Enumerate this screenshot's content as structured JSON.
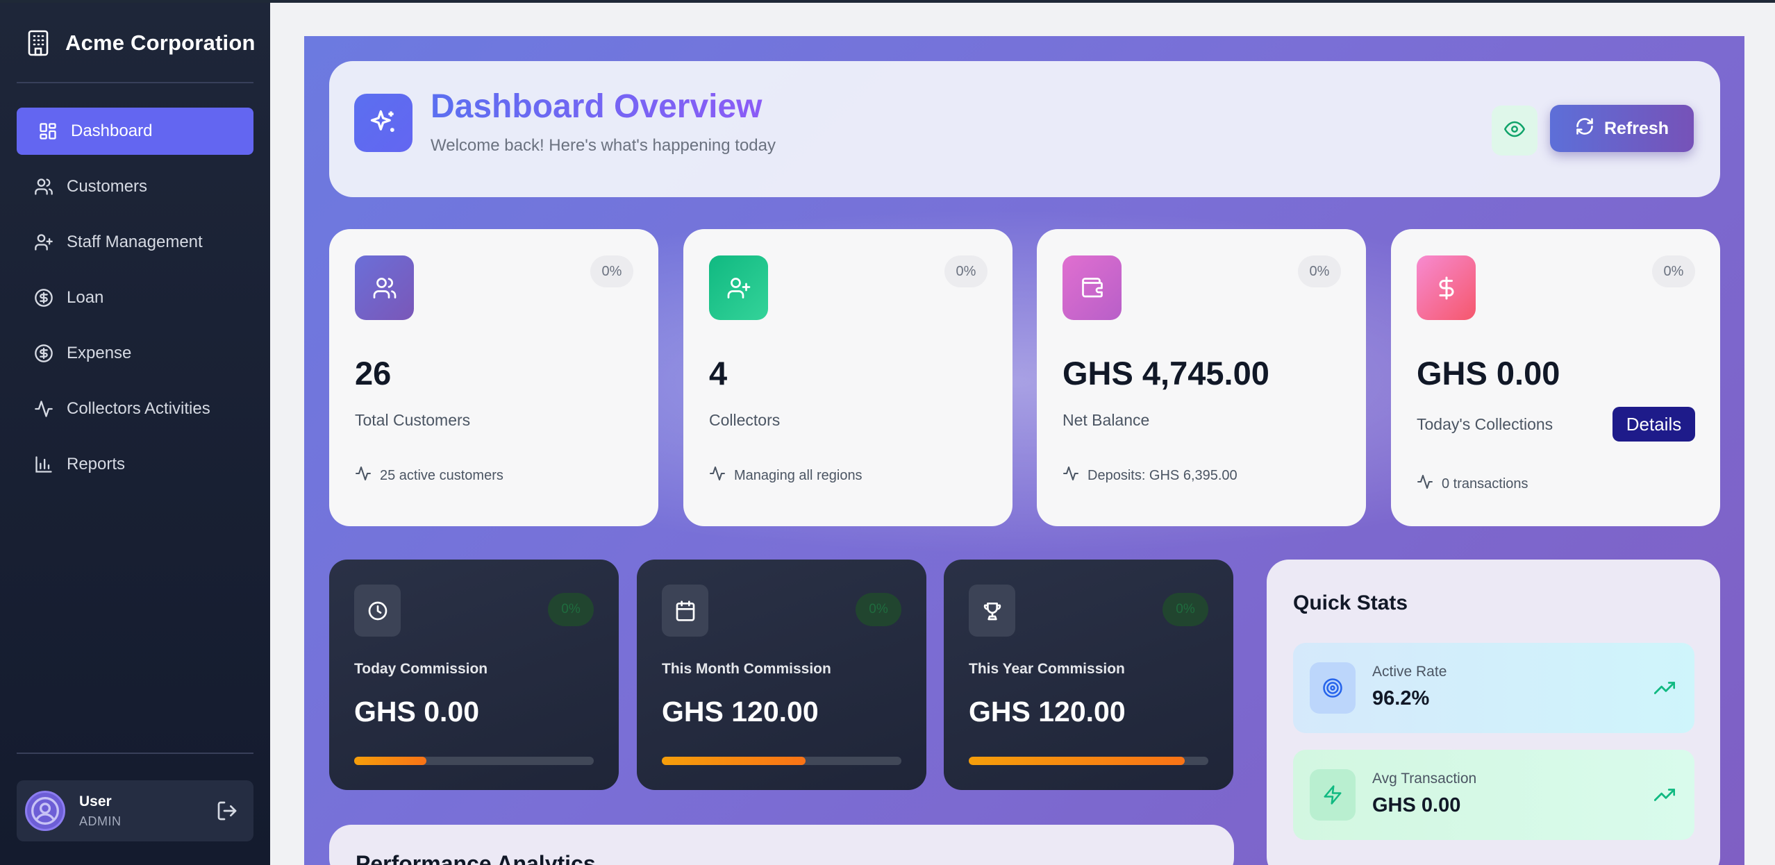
{
  "app": {
    "brand_name": "Acme Corporation"
  },
  "sidebar": {
    "items": [
      {
        "label": "Dashboard",
        "icon": "dashboard-icon",
        "active": true
      },
      {
        "label": "Customers",
        "icon": "users-icon",
        "active": false
      },
      {
        "label": "Staff Management",
        "icon": "user-plus-icon",
        "active": false
      },
      {
        "label": "Loan",
        "icon": "dollar-circle-icon",
        "active": false
      },
      {
        "label": "Expense",
        "icon": "dollar-circle-icon",
        "active": false
      },
      {
        "label": "Collectors Activities",
        "icon": "activity-icon",
        "active": false
      },
      {
        "label": "Reports",
        "icon": "bar-chart-icon",
        "active": false
      }
    ],
    "user": {
      "name": "User",
      "role": "ADMIN"
    }
  },
  "header": {
    "title": "Dashboard Overview",
    "subtitle": "Welcome back! Here's what's happening today",
    "refresh_label": "Refresh"
  },
  "stats": [
    {
      "value": "26",
      "label": "Total Customers",
      "pct": "0%",
      "foot": "25 active customers",
      "icon": "users-icon",
      "color_from": "#6b6fd8",
      "color_to": "#7a57b8"
    },
    {
      "value": "4",
      "label": "Collectors",
      "pct": "0%",
      "foot": "Managing all regions",
      "icon": "user-plus-icon",
      "color_from": "#10b981",
      "color_to": "#34d399"
    },
    {
      "value": "GHS 4,745.00",
      "label": "Net Balance",
      "pct": "0%",
      "foot": "Deposits: GHS 6,395.00",
      "icon": "wallet-icon",
      "color_from": "#e06fd0",
      "color_to": "#b85fc8"
    },
    {
      "value": "GHS 0.00",
      "label": "Today's Collections",
      "pct": "0%",
      "foot": "0 transactions",
      "icon": "dollar-icon",
      "color_from": "#f78bd1",
      "color_to": "#f5576c",
      "button": "Details"
    }
  ],
  "commissions": [
    {
      "label": "Today Commission",
      "value": "GHS 0.00",
      "pct": "0%",
      "icon": "clock-icon",
      "progress": 0.3
    },
    {
      "label": "This Month Commission",
      "value": "GHS 120.00",
      "pct": "0%",
      "icon": "calendar-icon",
      "progress": 0.6
    },
    {
      "label": "This Year Commission",
      "value": "GHS 120.00",
      "pct": "0%",
      "icon": "trophy-icon",
      "progress": 0.9
    }
  ],
  "quick_stats": {
    "title": "Quick Stats",
    "items": [
      {
        "label": "Active Rate",
        "value": "96.2%",
        "icon": "target-icon",
        "bg": "#cff3fb",
        "icon_bg": "#bcd6fb",
        "icon_color": "#2563eb"
      },
      {
        "label": "Avg Transaction",
        "value": "GHS 0.00",
        "icon": "zap-icon",
        "bg": "#d5f8e5",
        "icon_bg": "#b9efd0",
        "icon_color": "#10b981"
      }
    ]
  },
  "performance": {
    "title": "Performance Analytics"
  }
}
